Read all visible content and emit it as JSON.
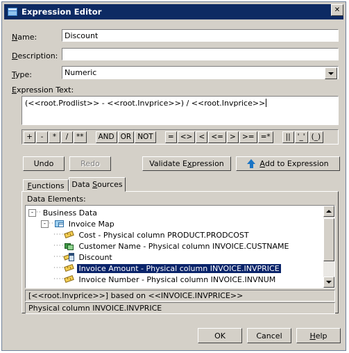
{
  "window": {
    "title": "Expression Editor",
    "icon": "window-icon",
    "close_label": "✕"
  },
  "form": {
    "name_label": "Name:",
    "name_accel": "N",
    "name_value": "Discount",
    "description_label": "Description:",
    "description_accel": "D",
    "description_value": "",
    "type_label": "Type:",
    "type_accel": "T",
    "type_value": "Numeric",
    "expression_label": "Expression Text:",
    "expression_accel": "E",
    "expression_value": "(<<root.Prodlist>> - <<root.Invprice>>) / <<root.Invprice>>"
  },
  "operators": {
    "group_math": [
      "+",
      "-",
      "*",
      "/",
      "**"
    ],
    "group_logic": [
      "AND",
      "OR",
      "NOT"
    ],
    "group_compare": [
      "=",
      "<>",
      "<",
      "<=",
      ">",
      ">=",
      "=*"
    ],
    "group_misc": [
      "||",
      "'_'",
      "(_)"
    ]
  },
  "actions": {
    "undo": "Undo",
    "redo": "Redo",
    "redo_enabled": false,
    "validate": "Validate Expression",
    "validate_accel": "x",
    "add": "Add to Expression",
    "add_accel": "A",
    "add_icon": "up-arrow-icon"
  },
  "tabs": [
    {
      "label": "Functions",
      "accel": "F",
      "active": false
    },
    {
      "label": "Data Sources",
      "accel": "S",
      "active": true
    }
  ],
  "tree": {
    "caption": "Data Elements:",
    "nodes": [
      {
        "label": "Business Data",
        "depth": 0,
        "expander": "-",
        "icon": "none",
        "selected": false
      },
      {
        "label": "Invoice Map",
        "depth": 1,
        "expander": "-",
        "icon": "map-icon",
        "selected": false
      },
      {
        "label": "Cost - Physical column PRODUCT.PRODCOST",
        "depth": 2,
        "expander": "",
        "icon": "ruler-icon",
        "selected": false
      },
      {
        "label": "Customer Name - Physical column INVOICE.CUSTNAME",
        "depth": 2,
        "expander": "",
        "icon": "green-book-icon",
        "selected": false
      },
      {
        "label": "Discount",
        "depth": 2,
        "expander": "",
        "icon": "calculator-icon",
        "selected": false
      },
      {
        "label": "Invoice Amount - Physical column INVOICE.INVPRICE",
        "depth": 2,
        "expander": "",
        "icon": "ruler-icon",
        "selected": true
      },
      {
        "label": "Invoice Number - Physical column INVOICE.INVNUM",
        "depth": 2,
        "expander": "",
        "icon": "ruler-icon",
        "selected": false
      }
    ]
  },
  "status": {
    "line1": "[<<root.Invprice>>] based on <<INVOICE.INVPRICE>>",
    "line2": "Physical column INVOICE.INVPRICE"
  },
  "footer": {
    "ok": "OK",
    "cancel": "Cancel",
    "help": "Help",
    "help_accel": "H"
  },
  "colors": {
    "titlebar": "#0d2a63",
    "dialog_face": "#d4d0c8",
    "selection": "#0a246a",
    "accent_arrow": "#1a74c4"
  }
}
